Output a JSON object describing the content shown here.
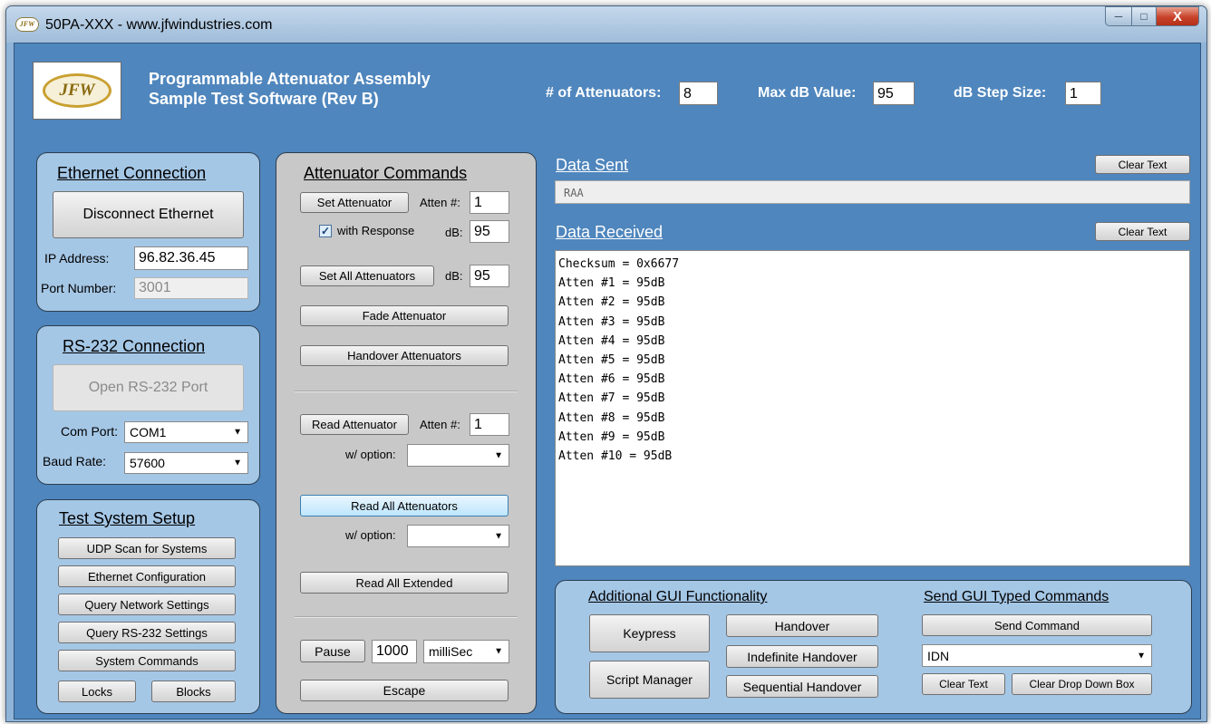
{
  "window": {
    "title": "50PA-XXX - www.jfwindustries.com",
    "icon_text": "JFW",
    "controls": [
      "minimize-icon",
      "maximize-icon",
      "close-icon"
    ]
  },
  "header": {
    "logo_text": "JFW",
    "title_line1": "Programmable Attenuator Assembly",
    "title_line2": "Sample Test Software (Rev B)",
    "num_attenuators_label": "# of Attenuators:",
    "num_attenuators_value": "8",
    "max_db_label": "Max dB Value:",
    "max_db_value": "95",
    "step_label": "dB Step Size:",
    "step_value": "1"
  },
  "ethernet": {
    "title": "Ethernet Connection",
    "disconnect_label": "Disconnect Ethernet",
    "ip_label": "IP Address:",
    "ip_value": "96.82.36.45",
    "port_label": "Port Number:",
    "port_value": "3001"
  },
  "rs232": {
    "title": "RS-232 Connection",
    "open_label": "Open RS-232 Port",
    "com_label": "Com Port:",
    "com_value": "COM1",
    "baud_label": "Baud Rate:",
    "baud_value": "57600"
  },
  "test_setup": {
    "title": "Test System Setup",
    "udp_scan": "UDP Scan for Systems",
    "eth_config": "Ethernet Configuration",
    "query_net": "Query Network Settings",
    "query_rs232": "Query RS-232 Settings",
    "system_commands": "System Commands",
    "locks": "Locks",
    "blocks": "Blocks"
  },
  "commands": {
    "title": "Attenuator Commands",
    "set_atten": "Set Attenuator",
    "atten_num_label": "Atten #:",
    "atten_num_value": "1",
    "with_response": "with Response",
    "with_response_checked": true,
    "db_label": "dB:",
    "db_value": "95",
    "set_all": "Set All Attenuators",
    "set_all_db_label": "dB:",
    "set_all_db_value": "95",
    "fade": "Fade Attenuator",
    "handover": "Handover Attenuators",
    "read_atten": "Read Attenuator",
    "read_atten_num_label": "Atten #:",
    "read_atten_num_value": "1",
    "option_label": "w/ option:",
    "option_value": "",
    "read_all": "Read All Attenuators",
    "read_all_option_label": "w/ option:",
    "read_all_option_value": "",
    "read_all_extended": "Read All Extended",
    "pause": "Pause",
    "pause_value": "1000",
    "pause_unit": "milliSec",
    "escape": "Escape"
  },
  "data_sent": {
    "title": "Data Sent",
    "clear": "Clear Text",
    "value": "RAA"
  },
  "data_received": {
    "title": "Data Received",
    "clear": "Clear Text",
    "lines": [
      "Checksum = 0x6677",
      "Atten #1 = 95dB",
      "Atten #2 = 95dB",
      "Atten #3 = 95dB",
      "Atten #4 = 95dB",
      "Atten #5 = 95dB",
      "Atten #6 = 95dB",
      "Atten #7 = 95dB",
      "Atten #8 = 95dB",
      "Atten #9 = 95dB",
      "Atten #10 = 95dB"
    ]
  },
  "additional": {
    "title": "Additional GUI Functionality",
    "keypress": "Keypress",
    "script_manager": "Script Manager",
    "handover": "Handover",
    "indefinite_handover": "Indefinite Handover",
    "sequential_handover": "Sequential Handover"
  },
  "typed": {
    "title": "Send GUI Typed Commands",
    "send": "Send Command",
    "command_value": "IDN",
    "clear_text": "Clear Text",
    "clear_dropdown": "Clear Drop Down Box"
  },
  "colors": {
    "client_bg": "#4f86bd",
    "panel_blue": "#a5c7e6",
    "panel_gray": "#c8c8c8",
    "close_red": "#c8422a"
  }
}
